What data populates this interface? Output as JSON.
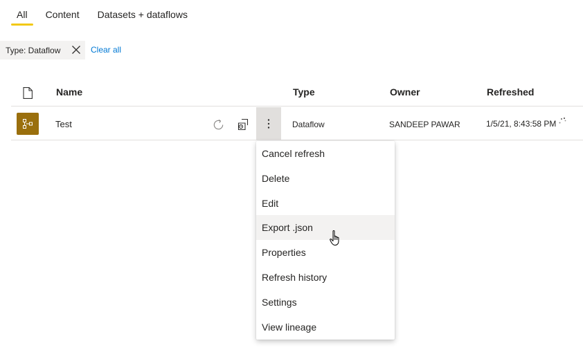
{
  "tabs": [
    {
      "label": "All",
      "active": true
    },
    {
      "label": "Content",
      "active": false
    },
    {
      "label": "Datasets + dataflows",
      "active": false
    }
  ],
  "filter": {
    "chip_label": "Type: Dataflow",
    "clear_all_label": "Clear all"
  },
  "table": {
    "headers": {
      "name": "Name",
      "type": "Type",
      "owner": "Owner",
      "refreshed": "Refreshed"
    },
    "rows": [
      {
        "name": "Test",
        "type": "Dataflow",
        "owner": "SANDEEP PAWAR",
        "refreshed": "1/5/21, 8:43:58 PM"
      }
    ]
  },
  "context_menu": {
    "items": [
      "Cancel refresh",
      "Delete",
      "Edit",
      "Export .json",
      "Properties",
      "Refresh history",
      "Settings",
      "View lineage"
    ],
    "hovered_item": "Export .json"
  },
  "colors": {
    "accent_tab": "#f2c811",
    "dataflow_icon_bg": "#9a6f0d",
    "link": "#0078d4"
  }
}
